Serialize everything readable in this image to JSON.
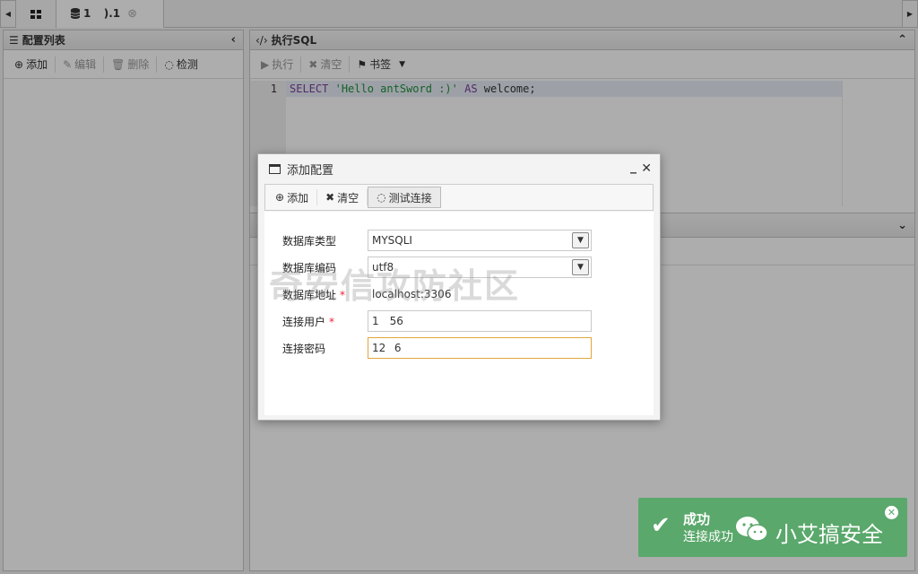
{
  "tabs": {
    "home_icon": "grid-icon",
    "db_tab_label": "1      ).1",
    "db_icon": "database-icon"
  },
  "left_panel": {
    "title": "配置列表",
    "toolbar": [
      {
        "label": "添加",
        "icon": "plus-circle-icon",
        "enabled": true
      },
      {
        "label": "编辑",
        "icon": "edit-icon",
        "enabled": false
      },
      {
        "label": "删除",
        "icon": "trash-icon",
        "enabled": false
      },
      {
        "label": "检测",
        "icon": "spinner-icon",
        "enabled": true
      }
    ]
  },
  "right_panel": {
    "title": "执行SQL",
    "toolbar": [
      {
        "label": "执行",
        "icon": "play-icon",
        "enabled": false
      },
      {
        "label": "清空",
        "icon": "times-icon",
        "enabled": false
      },
      {
        "label": "书签",
        "icon": "bookmark-icon",
        "enabled": true
      }
    ],
    "editor": {
      "line_number": "1",
      "kw_select": "SELECT",
      "string": "'Hello antSword :)'",
      "kw_as": "AS",
      "ident": "welcome;"
    }
  },
  "dialog": {
    "title": "添加配置",
    "toolbar": {
      "add_label": "添加",
      "clear_label": "清空",
      "test_label": "测试连接"
    },
    "fields": {
      "db_type_label": "数据库类型",
      "db_type_value": "MYSQLI",
      "db_encoding_label": "数据库编码",
      "db_encoding_value": "utf8",
      "db_host_label": "数据库地址",
      "db_host_value": "localhost:3306",
      "db_user_label": "连接用户",
      "db_user_value": "1     56",
      "db_pass_label": "连接密码",
      "db_pass_value": "12    6"
    }
  },
  "watermark": "奇安信攻防社区",
  "toast": {
    "title": "成功",
    "message": "连接成功",
    "brand": "小艾搞安全",
    "color": "#5aa86b"
  }
}
